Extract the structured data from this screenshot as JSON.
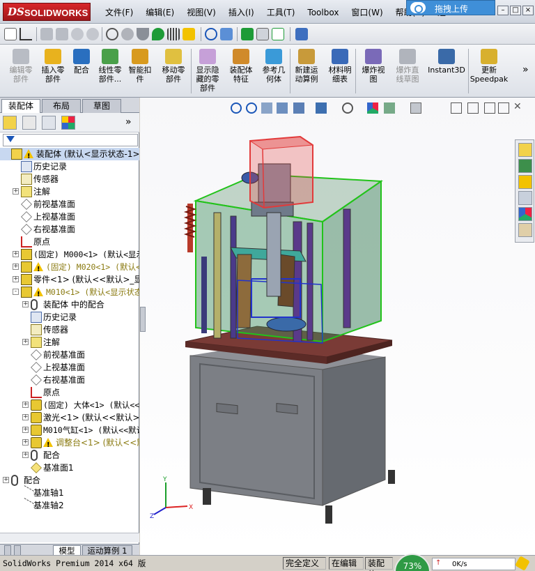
{
  "app": {
    "brand_ds": "DS",
    "brand_name": "SOLIDWORKS",
    "menu": [
      "文件(F)",
      "编辑(E)",
      "视图(V)",
      "插入(I)",
      "工具(T)",
      "Toolbox",
      "窗口(W)",
      "帮助(H)",
      "逆"
    ],
    "cloud_upload": "拖拽上传"
  },
  "command_manager": [
    {
      "label": "编辑零\n部件",
      "enabled": false
    },
    {
      "label": "插入零\n部件",
      "enabled": true
    },
    {
      "label": "配合",
      "enabled": true
    },
    {
      "label": "线性零\n部件...",
      "enabled": true
    },
    {
      "label": "智能扣\n件",
      "enabled": true
    },
    {
      "label": "移动零\n部件",
      "enabled": true
    },
    {
      "label": "显示隐\n藏的零\n部件",
      "enabled": true
    },
    {
      "label": "装配体\n特征",
      "enabled": true
    },
    {
      "label": "参考几\n何体",
      "enabled": true
    },
    {
      "label": "新建运\n动算例",
      "enabled": true
    },
    {
      "label": "材料明\n细表",
      "enabled": true
    },
    {
      "label": "爆炸视\n图",
      "enabled": true
    },
    {
      "label": "爆炸直\n线草图",
      "enabled": false
    },
    {
      "label": "Instant3D",
      "enabled": true
    },
    {
      "label": "更新\nSpeedpak",
      "enabled": true
    }
  ],
  "panel": {
    "tabs": [
      "装配体",
      "布局",
      "草图"
    ],
    "active_tab": "装配体",
    "expand_arrow": "»"
  },
  "tree": [
    {
      "text": "装配体  (默认<显示状态-1>)",
      "indent": 0,
      "icon": "assembly-icon",
      "warn": true,
      "expander": "",
      "selected": true
    },
    {
      "text": "历史记录",
      "indent": 1,
      "icon": "history-icon",
      "expander": ""
    },
    {
      "text": "传感器",
      "indent": 1,
      "icon": "sensor-icon",
      "expander": ""
    },
    {
      "text": "注解",
      "indent": 1,
      "icon": "annotation-icon",
      "expander": "+"
    },
    {
      "text": "前视基准面",
      "indent": 1,
      "icon": "plane-icon",
      "expander": ""
    },
    {
      "text": "上视基准面",
      "indent": 1,
      "icon": "plane-icon",
      "expander": ""
    },
    {
      "text": "右视基准面",
      "indent": 1,
      "icon": "plane-icon",
      "expander": ""
    },
    {
      "text": "原点",
      "indent": 1,
      "icon": "origin-icon",
      "expander": ""
    },
    {
      "text": "(固定) M000<1> (默认<显示状",
      "indent": 1,
      "icon": "subassembly-icon",
      "expander": "+"
    },
    {
      "text": "(固定) M020<1> (默认<显",
      "indent": 1,
      "icon": "subassembly-icon",
      "warn": true,
      "expander": "+",
      "dim": true
    },
    {
      "text": "零件<1> (默认<<默认>_显示状",
      "indent": 1,
      "icon": "subassembly-icon",
      "expander": "+"
    },
    {
      "text": "M010<1> (默认<显示状态-",
      "indent": 1,
      "icon": "subassembly-icon",
      "warn": true,
      "expander": "-",
      "dim": true
    },
    {
      "text": "装配体 中的配合",
      "indent": 2,
      "icon": "mates-icon",
      "expander": "+"
    },
    {
      "text": "历史记录",
      "indent": 2,
      "icon": "history-icon",
      "expander": ""
    },
    {
      "text": "传感器",
      "indent": 2,
      "icon": "sensor-icon",
      "expander": ""
    },
    {
      "text": "注解",
      "indent": 2,
      "icon": "annotation-icon",
      "expander": "+"
    },
    {
      "text": "前视基准面",
      "indent": 2,
      "icon": "plane-icon",
      "expander": ""
    },
    {
      "text": "上视基准面",
      "indent": 2,
      "icon": "plane-icon",
      "expander": ""
    },
    {
      "text": "右视基准面",
      "indent": 2,
      "icon": "plane-icon",
      "expander": ""
    },
    {
      "text": "原点",
      "indent": 2,
      "icon": "origin-icon",
      "expander": ""
    },
    {
      "text": "(固定) 大体<1> (默认<<",
      "indent": 2,
      "icon": "part-icon",
      "expander": "+"
    },
    {
      "text": "激光<1> (默认<<默认>_显",
      "indent": 2,
      "icon": "part-icon",
      "expander": "+"
    },
    {
      "text": "M010气缸<1> (默认<<默认",
      "indent": 2,
      "icon": "part-icon",
      "expander": "+"
    },
    {
      "text": "调整台<1> (默认<<默认",
      "indent": 2,
      "icon": "part-icon",
      "warn": true,
      "expander": "+",
      "dim": true
    },
    {
      "text": "配合",
      "indent": 2,
      "icon": "mates-icon",
      "expander": "+"
    },
    {
      "text": "基准面1",
      "indent": 2,
      "icon": "plane-yellow-icon",
      "expander": ""
    },
    {
      "text": "配合",
      "indent": 0,
      "icon": "mates-icon",
      "expander": "+"
    },
    {
      "text": "基准轴1",
      "indent": 1,
      "icon": "axis-icon",
      "expander": ""
    },
    {
      "text": "基准轴2",
      "indent": 1,
      "icon": "axis-icon",
      "expander": ""
    }
  ],
  "bottom_tabs": [
    "模型",
    "运动算例 1"
  ],
  "status": {
    "product": "SolidWorks Premium 2014 x64 版",
    "fully_defined": "完全定义",
    "editing": "在编辑",
    "editing_target": "装配体",
    "cpu_percent": "73%",
    "net_speed": "0K/s"
  },
  "colors": {
    "frame_green": "#22c31a",
    "glass": "#4e8a6a",
    "selection_red": "#e23a3a",
    "base_grey": "#74777d",
    "top_plate": "#7a3b36"
  }
}
